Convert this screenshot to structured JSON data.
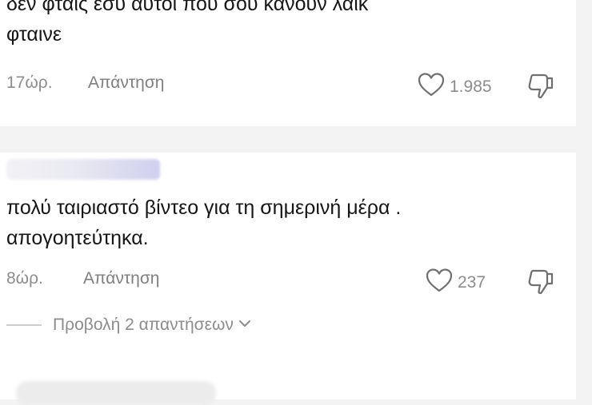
{
  "comments": [
    {
      "text_line1": "δεν φταις εσύ αυτοί που σου κάνουν λαικ",
      "text_line2": "φταινε",
      "time": "17ώρ.",
      "reply_label": "Απάντηση",
      "likes": "1.985"
    },
    {
      "text_line1": "πολύ ταιριαστό βίντεο για τη σημερινή μέρα .",
      "text_line2": "απογοητεύτηκα.",
      "time": "8ώρ.",
      "reply_label": "Απάντηση",
      "likes": "237",
      "view_replies_label": "Προβολή 2 απαντήσεων"
    }
  ],
  "icons": {
    "like": "heart-outline-icon",
    "dislike": "thumbs-down-outline-icon",
    "expand": "chevron-down-icon"
  },
  "colors": {
    "background": "#f3f3f3",
    "card": "#ffffff",
    "text": "#161616",
    "muted": "#8c8c8c"
  }
}
